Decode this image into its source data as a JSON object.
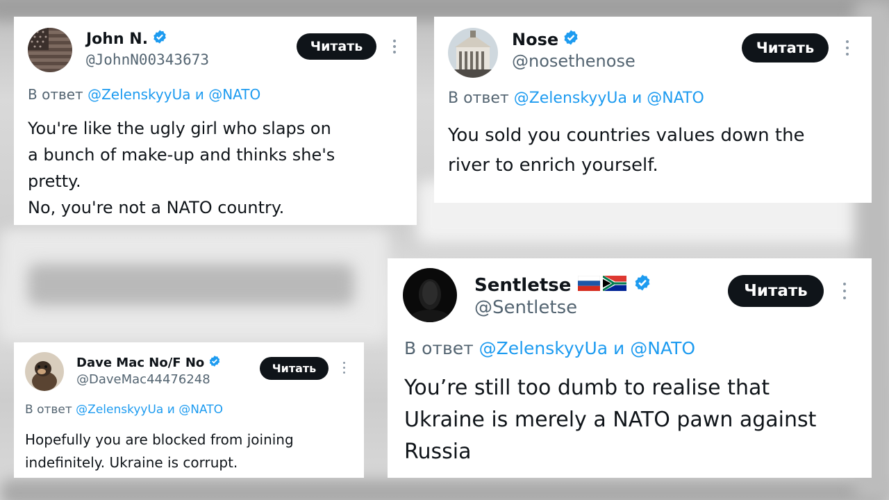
{
  "reply_prefix": "В ответ",
  "reply_and": "и",
  "follow_label": "Читать",
  "colors": {
    "verified": "#1d9bf0",
    "mention": "#1d9bf0",
    "button": "#0f1419",
    "handle": "#536471"
  },
  "tweets": [
    {
      "name": "John N.",
      "handle": "@JohnN00343673",
      "mention_1": "@ZelenskyyUa",
      "mention_2": "@NATO",
      "text": "You're like the ugly girl who slaps on\na bunch of make-up and thinks she's\npretty.\nNo, you're not a NATO country.",
      "avatar_icon": "us-flag-avatar"
    },
    {
      "name": "Nose",
      "handle": "@nosethenose",
      "mention_1": "@ZelenskyyUa",
      "mention_2": "@NATO",
      "text": "You sold you countries values down the\nriver to enrich yourself.",
      "avatar_icon": "building-avatar"
    },
    {
      "name": "Dave Mac No/F No",
      "handle": "@DaveMac44476248",
      "mention_1": "@ZelenskyyUa",
      "mention_2": "@NATO",
      "text": "Hopefully you are blocked from joining\nindefinitely. Ukraine is corrupt.",
      "avatar_icon": "dog-avatar"
    },
    {
      "name": "Sentletse",
      "handle": "@Sentletse",
      "mention_1": "@ZelenskyyUa",
      "mention_2": "@NATO",
      "text": "You’re still too dumb to realise that\nUkraine is merely a NATO pawn against\nRussia",
      "avatar_icon": "dark-portrait-avatar",
      "flags": [
        "russia-flag-icon",
        "south-africa-flag-icon"
      ]
    }
  ]
}
